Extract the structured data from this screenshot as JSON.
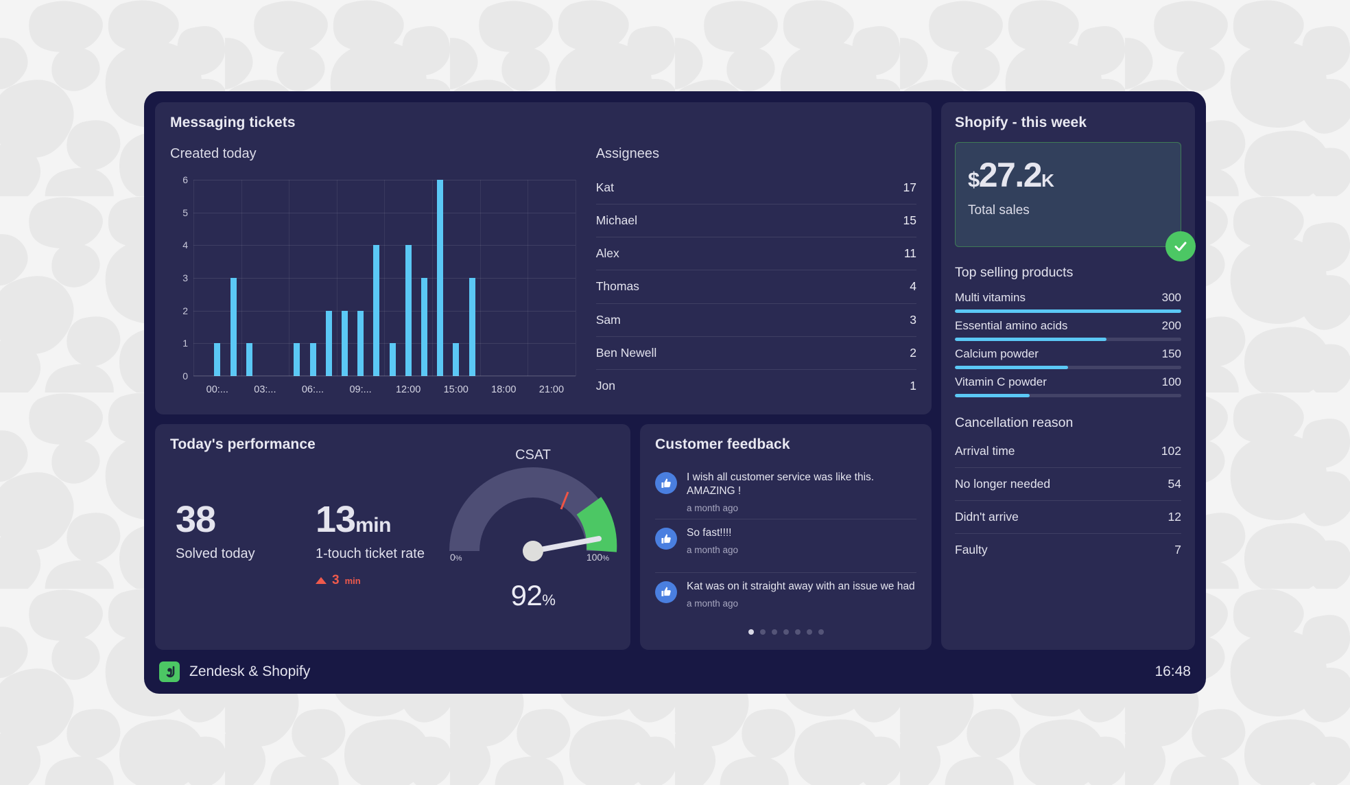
{
  "background": {
    "pattern": "pebble",
    "base_color": "#f4f4f4",
    "blob_color": "#e8e8e8"
  },
  "theme": {
    "shell_bg": "#181844",
    "panel_bg": "#2a2a52",
    "accent_cyan": "#5bc8f5",
    "accent_green": "#4cc764",
    "accent_red": "#ef5a4c",
    "accent_blue": "#4a7fe0"
  },
  "messaging": {
    "title": "Messaging tickets",
    "created_today_title": "Created today",
    "assignees_title": "Assignees",
    "assignees": [
      {
        "name": "Kat",
        "count": "17"
      },
      {
        "name": "Michael",
        "count": "15"
      },
      {
        "name": "Alex",
        "count": "11"
      },
      {
        "name": "Thomas",
        "count": "4"
      },
      {
        "name": "Sam",
        "count": "3"
      },
      {
        "name": "Ben Newell",
        "count": "2"
      },
      {
        "name": "Jon",
        "count": "1"
      }
    ]
  },
  "performance": {
    "title": "Today's performance",
    "solved": {
      "value": "38",
      "label": "Solved today"
    },
    "one_touch": {
      "value": "13",
      "unit": "min",
      "label": "1-touch ticket rate",
      "delta_value": "3",
      "delta_unit": "min",
      "delta_direction": "up"
    },
    "csat": {
      "label": "CSAT",
      "value": "92",
      "unit": "%",
      "min_label": "0",
      "min_unit": "%",
      "max_label": "100",
      "max_unit": "%"
    }
  },
  "feedback": {
    "title": "Customer feedback",
    "items": [
      {
        "icon": "thumbs-up-icon",
        "text": "I wish all customer service was like this. AMAZING !",
        "time": "a month ago"
      },
      {
        "icon": "thumbs-up-icon",
        "text": "So fast!!!!",
        "time": "a month ago"
      },
      {
        "icon": "thumbs-up-icon",
        "text": "Kat was on it straight away with an issue we had",
        "time": "a month ago"
      }
    ],
    "page_count": 7,
    "active_page": 0
  },
  "shopify": {
    "title": "Shopify - this week",
    "total_sales": {
      "currency": "$",
      "amount": "27.2",
      "suffix": "K",
      "label": "Total sales",
      "status_icon": "check-circle-icon"
    },
    "top_selling_title": "Top selling products",
    "top_selling": [
      {
        "name": "Multi vitamins",
        "value": "300",
        "pct": 100
      },
      {
        "name": "Essential amino acids",
        "value": "200",
        "pct": 67
      },
      {
        "name": "Calcium powder",
        "value": "150",
        "pct": 50
      },
      {
        "name": "Vitamin C powder",
        "value": "100",
        "pct": 33
      }
    ],
    "cancellation_title": "Cancellation reason",
    "cancellation": [
      {
        "reason": "Arrival time",
        "count": "102"
      },
      {
        "reason": "No longer needed",
        "count": "54"
      },
      {
        "reason": "Didn't arrive",
        "count": "12"
      },
      {
        "reason": "Faulty",
        "count": "7"
      }
    ]
  },
  "footer": {
    "logo_icon": "zendesk-logo-icon",
    "title": "Zendesk & Shopify",
    "time": "16:48"
  },
  "chart_data": {
    "type": "bar",
    "title": "Created today",
    "xlabel": "",
    "ylabel": "",
    "ylim": [
      0,
      6
    ],
    "yticks": [
      0,
      1,
      2,
      3,
      4,
      5,
      6
    ],
    "grid": true,
    "legend": false,
    "bar_color": "#5bc8f5",
    "xtick_labels": [
      "00:...",
      "03:...",
      "06:...",
      "09:...",
      "12:00",
      "15:00",
      "18:00",
      "21:00"
    ],
    "xtick_positions": [
      1,
      4,
      7,
      10,
      13,
      16,
      19,
      22
    ],
    "categories": [
      "00",
      "01",
      "02",
      "03",
      "04",
      "05",
      "06",
      "07",
      "08",
      "09",
      "10",
      "11",
      "12",
      "13",
      "14",
      "15",
      "16",
      "17",
      "18",
      "19",
      "20",
      "21",
      "22",
      "23"
    ],
    "values": [
      0,
      1,
      3,
      1,
      0,
      0,
      1,
      1,
      2,
      2,
      2,
      4,
      1,
      4,
      3,
      6,
      1,
      3,
      0,
      0,
      0,
      0,
      0,
      0
    ]
  }
}
